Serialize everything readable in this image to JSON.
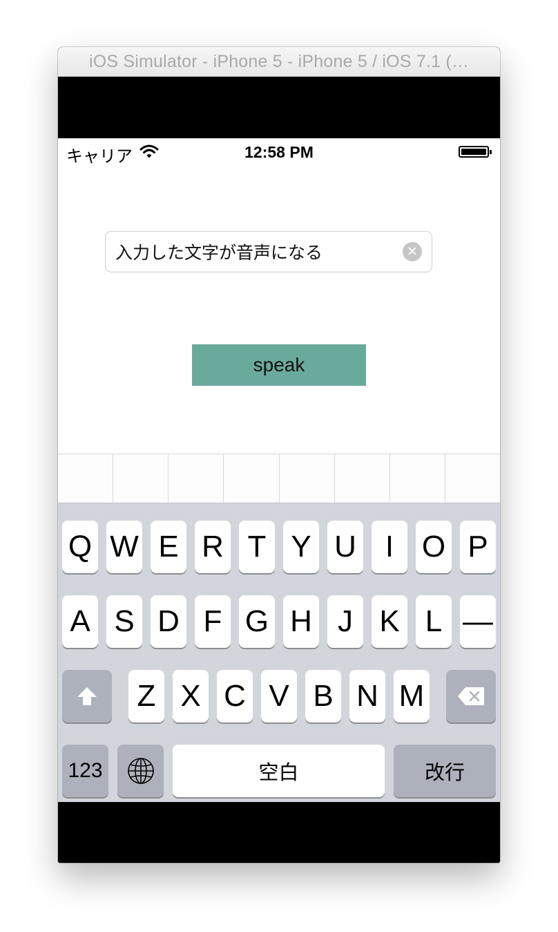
{
  "window": {
    "title": "iOS Simulator - iPhone 5 - iPhone 5 / iOS 7.1 (…"
  },
  "status_bar": {
    "carrier": "キャリア",
    "time": "12:58 PM",
    "battery_level": 1.0
  },
  "text_field": {
    "value": "入力した文字が音声になる",
    "clear_symbol": "✕"
  },
  "speak_button": {
    "label": "speak",
    "color": "#6aaa9c"
  },
  "candidate_bar": {
    "cell_count": 8
  },
  "keyboard": {
    "row1": [
      "Q",
      "W",
      "E",
      "R",
      "T",
      "Y",
      "U",
      "I",
      "O",
      "P"
    ],
    "row2": [
      "A",
      "S",
      "D",
      "F",
      "G",
      "H",
      "J",
      "K",
      "L",
      "—"
    ],
    "row3": [
      "Z",
      "X",
      "C",
      "V",
      "B",
      "N",
      "M"
    ],
    "numbers_label": "123",
    "space_label": "空白",
    "return_label": "改行",
    "shift_icon": "shift-arrow-icon",
    "delete_icon": "backspace-icon",
    "globe_icon": "globe-icon",
    "background_color": "#d2d5db",
    "special_key_color": "#acb1bb"
  }
}
